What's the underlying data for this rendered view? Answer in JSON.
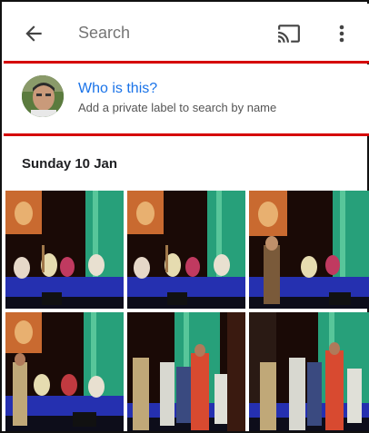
{
  "topbar": {
    "back_icon": "arrow-back-icon",
    "search_placeholder": "Search",
    "cast_icon": "cast-icon",
    "more_icon": "more-vert-icon"
  },
  "suggestion": {
    "title": "Who is this?",
    "subtitle": "Add a private label to search by name"
  },
  "section": {
    "date": "Sunday 10 Jan"
  },
  "colors": {
    "accent_red": "#d50000",
    "link_blue": "#1a73e8",
    "stage_blue": "#2233aa",
    "curtain_green": "#2a9e7c"
  },
  "photos": [
    {
      "id": "p1"
    },
    {
      "id": "p2"
    },
    {
      "id": "p3"
    },
    {
      "id": "p4"
    },
    {
      "id": "p5"
    },
    {
      "id": "p6"
    }
  ]
}
